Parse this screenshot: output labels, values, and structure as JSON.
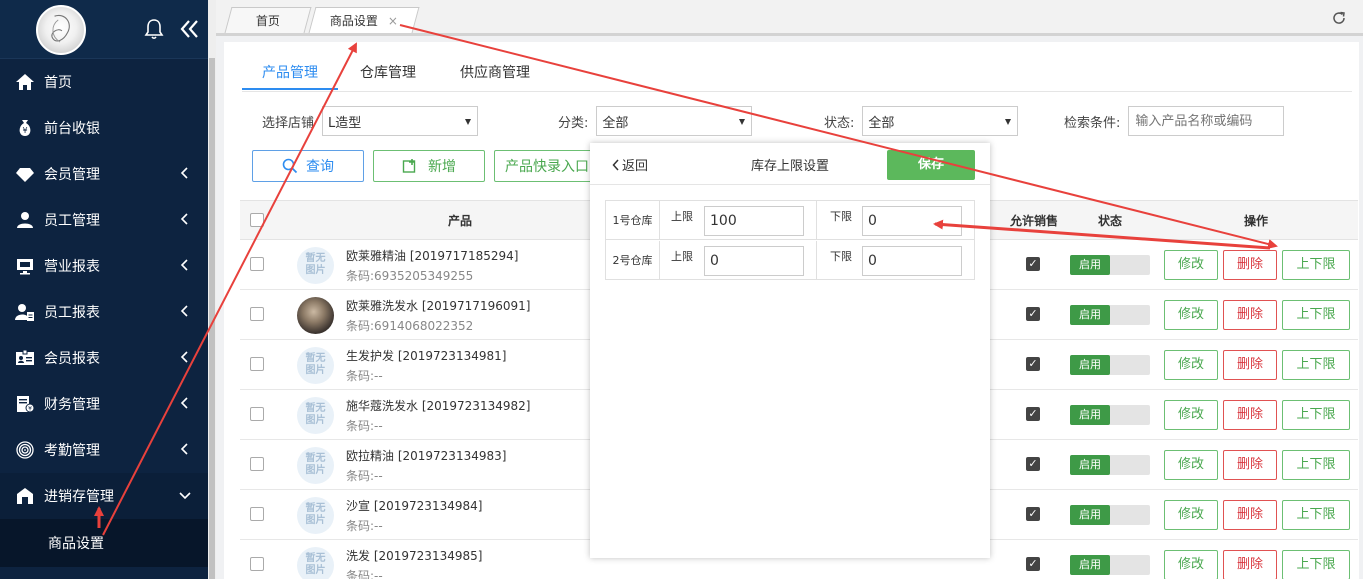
{
  "sidebar": {
    "items": [
      {
        "label": "首页",
        "icon": "home-icon"
      },
      {
        "label": "前台收银",
        "icon": "money-bag-icon"
      },
      {
        "label": "会员管理",
        "icon": "diamond-icon"
      },
      {
        "label": "员工管理",
        "icon": "user-icon"
      },
      {
        "label": "营业报表",
        "icon": "monitor-icon"
      },
      {
        "label": "员工报表",
        "icon": "user-report-icon"
      },
      {
        "label": "会员报表",
        "icon": "id-card-icon"
      },
      {
        "label": "财务管理",
        "icon": "finance-doc-icon"
      },
      {
        "label": "考勤管理",
        "icon": "fingerprint-icon"
      },
      {
        "label": "进销存管理",
        "icon": "warehouse-icon"
      }
    ],
    "sub_item": "商品设置"
  },
  "tabs": {
    "home": "首页",
    "goods": "商品设置",
    "close": "×"
  },
  "subtabs": [
    "产品管理",
    "仓库管理",
    "供应商管理"
  ],
  "filters": {
    "store_label": "选择店铺",
    "store_value": "L造型",
    "category_label": "分类:",
    "category_value": "全部",
    "status_label": "状态:",
    "status_value": "全部",
    "search_label": "检索条件:",
    "search_placeholder": "输入产品名称或编码"
  },
  "buttons": {
    "query": "查询",
    "add": "新增",
    "quick": "产品快录入口"
  },
  "table": {
    "headers": {
      "product": "产品",
      "allow_sale": "允许销售",
      "status": "状态",
      "ops": "操作"
    },
    "no_image": "暂无图片",
    "toggle_on": "启用",
    "actions": {
      "edit": "修改",
      "delete": "删除",
      "limits": "上下限"
    },
    "rows": [
      {
        "name": "欧莱雅精油 [2019717185294]",
        "code": "条码:6935205349255",
        "photo": false
      },
      {
        "name": "欧莱雅洗发水 [2019717196091]",
        "code": "条码:6914068022352",
        "photo": true
      },
      {
        "name": "生发护发 [2019723134981]",
        "code": "条码:--",
        "photo": false
      },
      {
        "name": "施华蔻洗发水 [2019723134982]",
        "code": "条码:--",
        "photo": false
      },
      {
        "name": "欧拉精油 [2019723134983]",
        "code": "条码:--",
        "photo": false
      },
      {
        "name": "沙宣 [2019723134984]",
        "code": "条码:--",
        "photo": false
      },
      {
        "name": "洗发 [2019723134985]",
        "code": "条码:--",
        "photo": false
      }
    ]
  },
  "modal": {
    "back": "返回",
    "title": "库存上限设置",
    "save": "保存",
    "warehouses": [
      {
        "name": "1号仓库",
        "upper_label": "上限",
        "upper": "100",
        "lower_label": "下限",
        "lower": "0"
      },
      {
        "name": "2号仓库",
        "upper_label": "上限",
        "upper": "0",
        "lower_label": "下限",
        "lower": "0"
      }
    ]
  },
  "colors": {
    "sidebar": "#0d2340",
    "accent": "#2d8cf0",
    "green": "#5cb85c",
    "danger": "#d9363e",
    "annotation": "#e8413c"
  }
}
